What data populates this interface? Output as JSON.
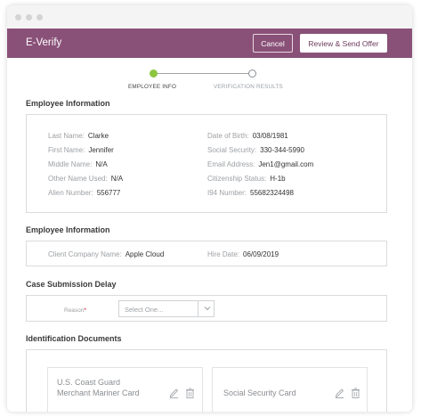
{
  "app": {
    "title": "E-Verify",
    "cancel_label": "Cancel",
    "review_label": "Review & Send Offer",
    "accent": "#8a5178",
    "step_active_color": "#8dc63f"
  },
  "stepper": {
    "steps": [
      {
        "label": "EMPLOYEE INFO",
        "state": "active"
      },
      {
        "label": "VERIFICATION RESULTS",
        "state": "inactive"
      }
    ]
  },
  "employee_info": {
    "title": "Employee Information",
    "left": [
      {
        "label": "Last Name:",
        "value": "Clarke"
      },
      {
        "label": "First Name:",
        "value": "Jennifer"
      },
      {
        "label": "Middle Name:",
        "value": "N/A"
      },
      {
        "label": "Other Name Used:",
        "value": "N/A"
      },
      {
        "label": "Alien Number:",
        "value": "556777"
      }
    ],
    "right": [
      {
        "label": "Date of Birth:",
        "value": "03/08/1981"
      },
      {
        "label": "Social Security:",
        "value": "330-344-5990"
      },
      {
        "label": "Email Address:",
        "value": "Jen1@gmail.com"
      },
      {
        "label": "Citizenship Status:",
        "value": "H-1b"
      },
      {
        "label": "I94 Number:",
        "value": "55682324498"
      }
    ]
  },
  "employment_info": {
    "title": "Employee Information",
    "company_label": "Client Company Name:",
    "company_value": "Apple Cloud",
    "hire_label": "Hire Date:",
    "hire_value": "06/09/2019"
  },
  "case_delay": {
    "title": "Case Submission Delay",
    "reason_label": "Reason",
    "required_mark": "*",
    "select_placeholder": "Select One..."
  },
  "documents": {
    "title": "Identification Documents",
    "items": [
      {
        "line1": "U.S. Coast Guard",
        "line2": "Merchant Mariner Card"
      },
      {
        "line1": "Social Security Card",
        "line2": ""
      }
    ]
  }
}
